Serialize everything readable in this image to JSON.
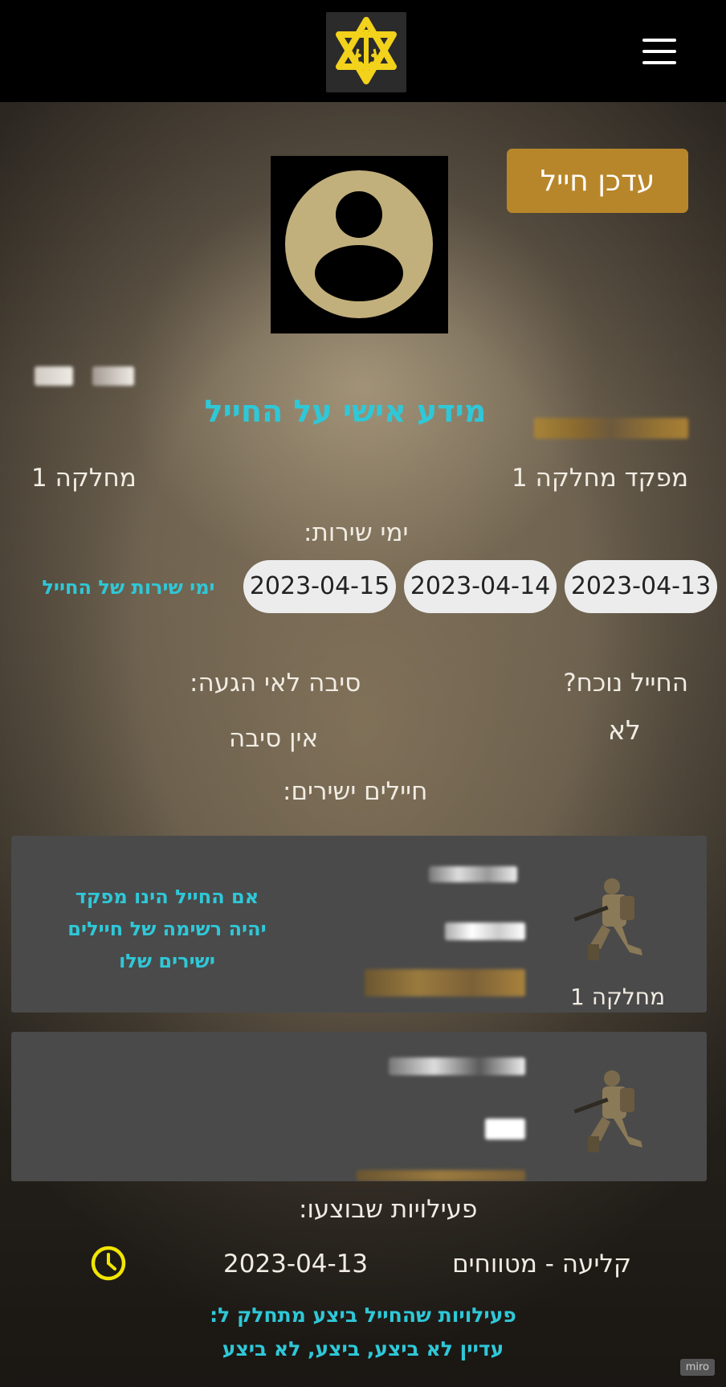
{
  "header": {
    "logo_icon": "idf-star-sword-olive-logo",
    "menu_icon": "hamburger-menu-icon"
  },
  "profile": {
    "update_button": "עדכן חייל",
    "avatar_icon": "user-avatar-icon",
    "section_title": "מידע אישי על החייל",
    "role": "מפקד מחלקה 1",
    "unit": "מחלקה 1",
    "service_days_label": "ימי שירות:",
    "service_days": [
      "2023-04-13",
      "2023-04-14",
      "2023-04-15"
    ],
    "service_days_hint": "ימי שירות של החייל",
    "present_label": "החייל נוכח?",
    "present_value": "לא",
    "absence_reason_label": "סיבה לאי הגעה:",
    "absence_reason_value": "אין סיבה",
    "direct_soldiers_label": "חיילים ישירים:"
  },
  "direct_soldiers": [
    {
      "unit": "מחלקה 1",
      "image_icon": "kneeling-soldier-image"
    },
    {
      "image_icon": "kneeling-soldier-image"
    }
  ],
  "direct_soldiers_hint": [
    "אם החייל הינו מפקד",
    "יהיה רשימה של חיילים",
    "ישירים שלו"
  ],
  "activities": {
    "label": "פעילויות שבוצעו:",
    "items": [
      {
        "name": "קליעה - מטווחים",
        "date": "2023-04-13",
        "status_icon": "clock-icon"
      }
    ],
    "hint_line1": "פעילויות שהחייל ביצע  מתחלק ל:",
    "hint_line2": "עדיין לא ביצע, ביצע, לא ביצע"
  },
  "watermark": "miro",
  "colors": {
    "accent_cyan": "#2fc8d8",
    "button_gold": "#b8862a",
    "avatar_tan": "#c2b07c",
    "clock_yellow": "#f2e600",
    "card_gray": "#4a4a4a"
  }
}
